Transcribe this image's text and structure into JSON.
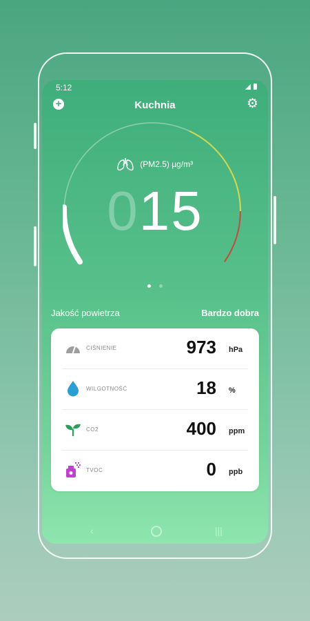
{
  "status_bar": {
    "time": "5:12"
  },
  "header": {
    "title": "Kuchnia",
    "add_icon": "plus-circle-icon",
    "settings_icon": "gear-icon"
  },
  "gauge": {
    "unit_label": "(PM2.5) µg/m³",
    "reading_leading": "0",
    "reading_value": "15",
    "level": 0.15,
    "colors": {
      "track": "#8fd0ad",
      "progress": "#ffffff",
      "moderate": "#d8d84e",
      "unhealthy": "#c8483c"
    }
  },
  "page_indicator": {
    "count": 2,
    "active": 0
  },
  "air_quality": {
    "label": "Jakość powietrza",
    "value": "Bardzo dobra"
  },
  "metrics": [
    {
      "name": "CIŚNIENIE",
      "value": "973",
      "unit": "hPa",
      "icon": "pressure-gauge-icon"
    },
    {
      "name": "WILGOTNOŚĆ",
      "value": "18",
      "unit": "%",
      "icon": "water-drop-icon"
    },
    {
      "name": "CO2",
      "value": "400",
      "unit": "ppm",
      "icon": "sprout-icon"
    },
    {
      "name": "TVOC",
      "value": "0",
      "unit": "ppb",
      "icon": "spray-bottle-icon"
    }
  ],
  "nav": {
    "back": "‹",
    "recent": "|||"
  }
}
